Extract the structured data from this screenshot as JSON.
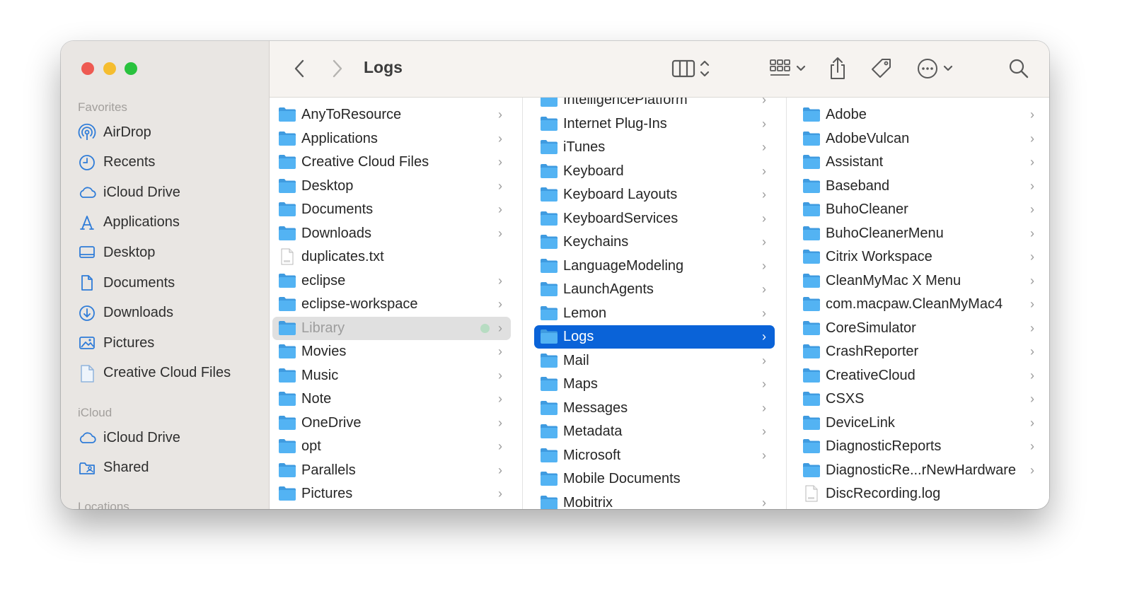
{
  "window": {
    "title": "Logs"
  },
  "colors": {
    "accent": "#0a63d8",
    "folder": "#53b3f3",
    "sidebar_icon": "#2f7cd8"
  },
  "sidebar": {
    "favorites_title": "Favorites",
    "favorites": [
      {
        "label": "AirDrop",
        "icon": "airdrop-icon"
      },
      {
        "label": "Recents",
        "icon": "clock-icon"
      },
      {
        "label": "iCloud Drive",
        "icon": "cloud-icon"
      },
      {
        "label": "Applications",
        "icon": "applications-icon"
      },
      {
        "label": "Desktop",
        "icon": "desktop-icon"
      },
      {
        "label": "Documents",
        "icon": "document-icon"
      },
      {
        "label": "Downloads",
        "icon": "download-icon"
      },
      {
        "label": "Pictures",
        "icon": "photo-icon"
      },
      {
        "label": "Creative Cloud Files",
        "icon": "file-icon"
      }
    ],
    "icloud_title": "iCloud",
    "icloud": [
      {
        "label": "iCloud Drive",
        "icon": "cloud-icon"
      },
      {
        "label": "Shared",
        "icon": "shared-folder-icon"
      }
    ],
    "locations_title": "Locations"
  },
  "columns": [
    {
      "items": [
        {
          "label": "AnyToResource",
          "kind": "folder",
          "chevron": true
        },
        {
          "label": "Applications",
          "kind": "folder",
          "chevron": true
        },
        {
          "label": "Creative Cloud Files",
          "kind": "folder",
          "chevron": true
        },
        {
          "label": "Desktop",
          "kind": "folder",
          "chevron": true
        },
        {
          "label": "Documents",
          "kind": "folder",
          "chevron": true
        },
        {
          "label": "Downloads",
          "kind": "folder",
          "chevron": true
        },
        {
          "label": "duplicates.txt",
          "kind": "file",
          "chevron": false
        },
        {
          "label": "eclipse",
          "kind": "folder",
          "chevron": true
        },
        {
          "label": "eclipse-workspace",
          "kind": "folder",
          "chevron": true
        },
        {
          "label": "Library",
          "kind": "folder",
          "chevron": true,
          "state": "dim"
        },
        {
          "label": "Movies",
          "kind": "folder",
          "chevron": true
        },
        {
          "label": "Music",
          "kind": "folder",
          "chevron": true
        },
        {
          "label": "Note",
          "kind": "folder",
          "chevron": true
        },
        {
          "label": "OneDrive",
          "kind": "folder",
          "chevron": true
        },
        {
          "label": "opt",
          "kind": "folder",
          "chevron": true
        },
        {
          "label": "Parallels",
          "kind": "folder",
          "chevron": true
        },
        {
          "label": "Pictures",
          "kind": "folder",
          "chevron": true
        }
      ]
    },
    {
      "items": [
        {
          "label": "IntelligencePlatform",
          "kind": "folder",
          "chevron": true
        },
        {
          "label": "Internet Plug-Ins",
          "kind": "folder",
          "chevron": true
        },
        {
          "label": "iTunes",
          "kind": "folder",
          "chevron": true
        },
        {
          "label": "Keyboard",
          "kind": "folder",
          "chevron": true
        },
        {
          "label": "Keyboard Layouts",
          "kind": "folder",
          "chevron": true
        },
        {
          "label": "KeyboardServices",
          "kind": "folder",
          "chevron": true
        },
        {
          "label": "Keychains",
          "kind": "folder",
          "chevron": true
        },
        {
          "label": "LanguageModeling",
          "kind": "folder",
          "chevron": true
        },
        {
          "label": "LaunchAgents",
          "kind": "folder",
          "chevron": true
        },
        {
          "label": "Lemon",
          "kind": "folder",
          "chevron": true
        },
        {
          "label": "Logs",
          "kind": "folder",
          "chevron": true,
          "state": "selected"
        },
        {
          "label": "Mail",
          "kind": "folder",
          "chevron": true
        },
        {
          "label": "Maps",
          "kind": "folder",
          "chevron": true
        },
        {
          "label": "Messages",
          "kind": "folder",
          "chevron": true
        },
        {
          "label": "Metadata",
          "kind": "folder",
          "chevron": true
        },
        {
          "label": "Microsoft",
          "kind": "folder",
          "chevron": true
        },
        {
          "label": "Mobile Documents",
          "kind": "folder",
          "chevron": false
        },
        {
          "label": "Mobitrix",
          "kind": "folder",
          "chevron": true
        }
      ]
    },
    {
      "items": [
        {
          "label": "Adobe",
          "kind": "folder",
          "chevron": true
        },
        {
          "label": "AdobeVulcan",
          "kind": "folder",
          "chevron": true
        },
        {
          "label": "Assistant",
          "kind": "folder",
          "chevron": true
        },
        {
          "label": "Baseband",
          "kind": "folder",
          "chevron": true
        },
        {
          "label": "BuhoCleaner",
          "kind": "folder",
          "chevron": true
        },
        {
          "label": "BuhoCleanerMenu",
          "kind": "folder",
          "chevron": true
        },
        {
          "label": "Citrix Workspace",
          "kind": "folder",
          "chevron": true
        },
        {
          "label": "CleanMyMac X Menu",
          "kind": "folder",
          "chevron": true
        },
        {
          "label": "com.macpaw.CleanMyMac4",
          "kind": "folder",
          "chevron": true
        },
        {
          "label": "CoreSimulator",
          "kind": "folder",
          "chevron": true
        },
        {
          "label": "CrashReporter",
          "kind": "folder",
          "chevron": true
        },
        {
          "label": "CreativeCloud",
          "kind": "folder",
          "chevron": true
        },
        {
          "label": "CSXS",
          "kind": "folder",
          "chevron": true
        },
        {
          "label": "DeviceLink",
          "kind": "folder",
          "chevron": true
        },
        {
          "label": "DiagnosticReports",
          "kind": "folder",
          "chevron": true
        },
        {
          "label": "DiagnosticRe...rNewHardware",
          "kind": "folder",
          "chevron": true
        },
        {
          "label": "DiscRecording.log",
          "kind": "file",
          "chevron": false
        }
      ]
    }
  ]
}
